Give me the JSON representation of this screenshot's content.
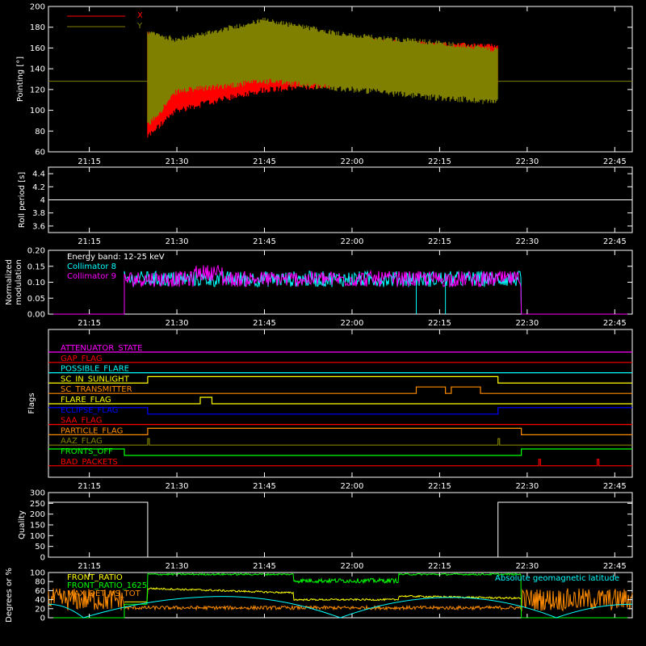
{
  "chart_data": [
    {
      "type": "line",
      "ylabel": "Pointing [°]",
      "ylim": [
        60,
        200
      ],
      "yticks": [
        60,
        80,
        100,
        120,
        140,
        160,
        180,
        200
      ],
      "xlim": [
        "21:08",
        "22:48"
      ],
      "xticks": [
        "21:15",
        "21:30",
        "21:45",
        "22:00",
        "22:15",
        "22:30",
        "22:45"
      ],
      "legend": [
        "X",
        "Y"
      ],
      "colors": {
        "X": "#ff0000",
        "Y": "#808000"
      },
      "series": [
        {
          "name": "X",
          "x": [
            "21:25",
            "21:30",
            "21:45",
            "22:00",
            "22:15",
            "22:25"
          ],
          "upper": [
            175,
            140,
            170,
            168,
            164,
            162
          ],
          "lower": [
            75,
            100,
            120,
            125,
            125,
            125
          ]
        },
        {
          "name": "Y",
          "x": [
            "21:25",
            "21:30",
            "21:45",
            "22:00",
            "22:15",
            "22:25"
          ],
          "upper": [
            175,
            168,
            187,
            172,
            165,
            158
          ],
          "lower": [
            85,
            118,
            128,
            120,
            112,
            108
          ]
        }
      ],
      "flat_line_y": 128
    },
    {
      "type": "line",
      "ylabel": "Roll period [s]",
      "ylim": [
        3.5,
        4.5
      ],
      "yticks": [
        3.6,
        3.8,
        4.0,
        4.2,
        4.4
      ],
      "xticks": [
        "21:15",
        "21:30",
        "21:45",
        "22:00",
        "22:15",
        "22:30",
        "22:45"
      ],
      "series": [
        {
          "values": [
            4.0,
            4.0
          ]
        }
      ]
    },
    {
      "type": "line",
      "ylabel": "Normalized modulation",
      "ylim": [
        0.0,
        0.2
      ],
      "yticks": [
        "0.00",
        "0.05",
        "0.10",
        "0.15",
        "0.20"
      ],
      "xticks": [
        "21:15",
        "21:30",
        "21:45",
        "22:00",
        "22:15",
        "22:30",
        "22:45"
      ],
      "annotation": "Energy band: 12-25 keV",
      "legend": [
        "Collimator 8",
        "Collimator 9"
      ],
      "colors": {
        "Collimator 8": "#00ffff",
        "Collimator 9": "#ff00ff"
      },
      "active_range": [
        "21:21",
        "22:29"
      ],
      "mean_value": 0.11
    },
    {
      "type": "line",
      "ylabel": "Flags",
      "xticks": [
        "21:15",
        "21:30",
        "21:45",
        "22:00",
        "22:15",
        "22:30",
        "22:45"
      ],
      "flags": [
        {
          "name": "ATTENUATOR_STATE",
          "color": "#ff00ff",
          "segments": []
        },
        {
          "name": "GAP_FLAG",
          "color": "#ff0000",
          "segments": []
        },
        {
          "name": "POSSIBLE_FLARE",
          "color": "#00ffff",
          "segments": []
        },
        {
          "name": "SC_IN_SUNLIGHT",
          "color": "#ffff00",
          "segments": [
            [
              "21:25",
              "22:25"
            ]
          ]
        },
        {
          "name": "SC_TRANSMITTER",
          "color": "#ff8c00",
          "segments": [
            [
              "22:11",
              "22:16"
            ],
            [
              "22:17",
              "22:22"
            ]
          ]
        },
        {
          "name": "FLARE_FLAG",
          "color": "#ffff00",
          "segments": [
            [
              "21:34",
              "21:36"
            ]
          ]
        },
        {
          "name": "ECLIPSE_FLAG",
          "color": "#0000ff",
          "segments": [
            [
              "21:08",
              "21:25"
            ],
            [
              "22:25",
              "22:48"
            ]
          ]
        },
        {
          "name": "SAA_FLAG",
          "color": "#ff0000",
          "segments": []
        },
        {
          "name": "PARTICLE_FLAG",
          "color": "#ff8c00",
          "segments": [
            [
              "21:25",
              "22:29"
            ]
          ]
        },
        {
          "name": "AAZ_FLAG",
          "color": "#808000",
          "segments": [
            [
              "21:25",
              "21:25"
            ],
            [
              "22:25",
              "22:25"
            ]
          ]
        },
        {
          "name": "FRONTS_OFF",
          "color": "#00ff00",
          "segments": [
            [
              "21:08",
              "21:21"
            ],
            [
              "22:29",
              "22:48"
            ]
          ]
        },
        {
          "name": "BAD_PACKETS",
          "color": "#ff0000",
          "segments": [
            [
              "22:32",
              "22:32"
            ],
            [
              "22:42",
              "22:42"
            ]
          ]
        }
      ]
    },
    {
      "type": "line",
      "ylabel": "Quality",
      "ylim": [
        0,
        300
      ],
      "yticks": [
        0,
        50,
        100,
        150,
        200,
        250,
        300
      ],
      "xticks": [
        "21:15",
        "21:30",
        "21:45",
        "22:00",
        "22:15",
        "22:30",
        "22:45"
      ],
      "x": [
        "21:08",
        "21:25",
        "21:25",
        "22:25",
        "22:25",
        "22:48"
      ],
      "values": [
        255,
        255,
        0,
        0,
        255,
        255
      ]
    },
    {
      "type": "line",
      "ylabel": "Degrees or %",
      "ylim": [
        0,
        100
      ],
      "yticks": [
        0,
        20,
        40,
        60,
        80,
        100
      ],
      "legend": [
        "FRONT_RATIO",
        "FRONT_RATIO_1625",
        "MAX_DET_VS_TOT",
        "Absolute geomagnetic latitude"
      ],
      "colors": {
        "FRONT_RATIO": "#ffff00",
        "FRONT_RATIO_1625": "#00ff00",
        "MAX_DET_VS_TOT": "#ff8c00",
        "Absolute geomagnetic latitude": "#00ffff"
      },
      "series": [
        {
          "name": "Absolute geomagnetic latitude",
          "x": [
            "21:08",
            "21:14",
            "21:38",
            "21:58",
            "22:17",
            "22:35",
            "22:48"
          ],
          "values": [
            30,
            0,
            47,
            0,
            45,
            0,
            30
          ]
        }
      ]
    }
  ],
  "flags_title_text": "Flags",
  "panels": {
    "p1": {
      "ylabel": "Pointing [°]",
      "legend_x": "X",
      "legend_y": "Y"
    },
    "p2": {
      "ylabel": "Roll period [s]"
    },
    "p3": {
      "ylabel1": "Normalized",
      "ylabel2": "modulation",
      "energy": "Energy band: 12-25 keV",
      "leg8": "Collimator 8",
      "leg9": "Collimator 9"
    },
    "p5": {
      "ylabel": "Quality"
    },
    "p6": {
      "ylabel": "Degrees or %",
      "leg1": "FRONT_RATIO",
      "leg2": "FRONT_RATIO_1625",
      "leg3": "MAX_DET_VS_TOT",
      "leg4": "Absolute geomagnetic latitude"
    }
  },
  "xticks": [
    "21:15",
    "21:30",
    "21:45",
    "22:00",
    "22:15",
    "22:30",
    "22:45"
  ]
}
